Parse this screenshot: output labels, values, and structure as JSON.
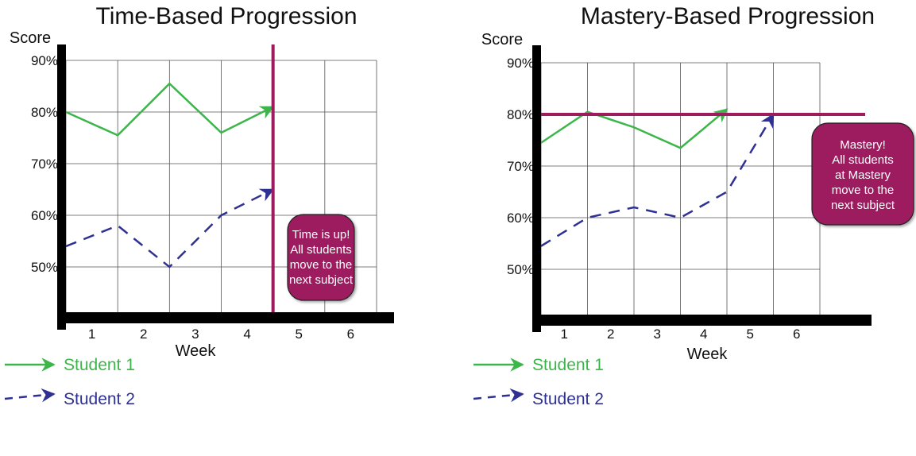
{
  "colors": {
    "student1": "#3cb54a",
    "student2": "#2e3192",
    "threshold": "#9c1c5e",
    "axis": "#000000",
    "grid": "#555555"
  },
  "chart_data": [
    {
      "type": "line",
      "title": "Time-Based Progression",
      "ylabel": "Score",
      "xlabel": "Week",
      "x_tick_labels": [
        "1",
        "2",
        "3",
        "4",
        "5",
        "6"
      ],
      "y_tick_labels": [
        "90%",
        "80%",
        "70%",
        "60%",
        "50%"
      ],
      "y_ticks": [
        90,
        80,
        70,
        60,
        50
      ],
      "ylim": [
        40,
        90
      ],
      "xlim": [
        0.5,
        6.5
      ],
      "grid": true,
      "series": [
        {
          "name": "Student 1",
          "style": "solid-arrow",
          "x": [
            0.5,
            1.5,
            2.5,
            3.5,
            4.5
          ],
          "y": [
            80,
            75.5,
            85.5,
            76,
            81
          ]
        },
        {
          "name": "Student 2",
          "style": "dashed-arrow",
          "x": [
            0.5,
            1.5,
            2.5,
            3.5,
            4.5
          ],
          "y": [
            54,
            58,
            50,
            60,
            65
          ]
        }
      ],
      "marker_line": {
        "orientation": "vertical",
        "value": 4.5
      },
      "annotation": [
        "Time is up!",
        "All students",
        "move to the",
        "next subject"
      ]
    },
    {
      "type": "line",
      "title": "Mastery-Based Progression",
      "ylabel": "Score",
      "xlabel": "Week",
      "x_tick_labels": [
        "1",
        "2",
        "3",
        "4",
        "5",
        "6"
      ],
      "y_tick_labels": [
        "90%",
        "80%",
        "70%",
        "60%",
        "50%"
      ],
      "y_ticks": [
        90,
        80,
        70,
        60,
        50
      ],
      "ylim": [
        40,
        90
      ],
      "xlim": [
        0.5,
        6.5
      ],
      "grid": true,
      "series": [
        {
          "name": "Student 1",
          "style": "solid-arrow",
          "x": [
            0.5,
            1.5,
            2.5,
            3.5,
            4.5
          ],
          "y": [
            74.5,
            80.5,
            77.5,
            73.5,
            81
          ]
        },
        {
          "name": "Student 2",
          "style": "dashed-arrow",
          "x": [
            0.5,
            1.5,
            2.5,
            3.5,
            4.5,
            5.5
          ],
          "y": [
            54.5,
            60,
            62,
            60,
            65,
            80
          ]
        }
      ],
      "marker_line": {
        "orientation": "horizontal",
        "value": 80
      },
      "annotation": [
        "Mastery!",
        "All students",
        "at Mastery",
        "move to the",
        "next subject"
      ]
    }
  ],
  "legend": [
    {
      "label": "Student 1"
    },
    {
      "label": "Student 2"
    }
  ]
}
